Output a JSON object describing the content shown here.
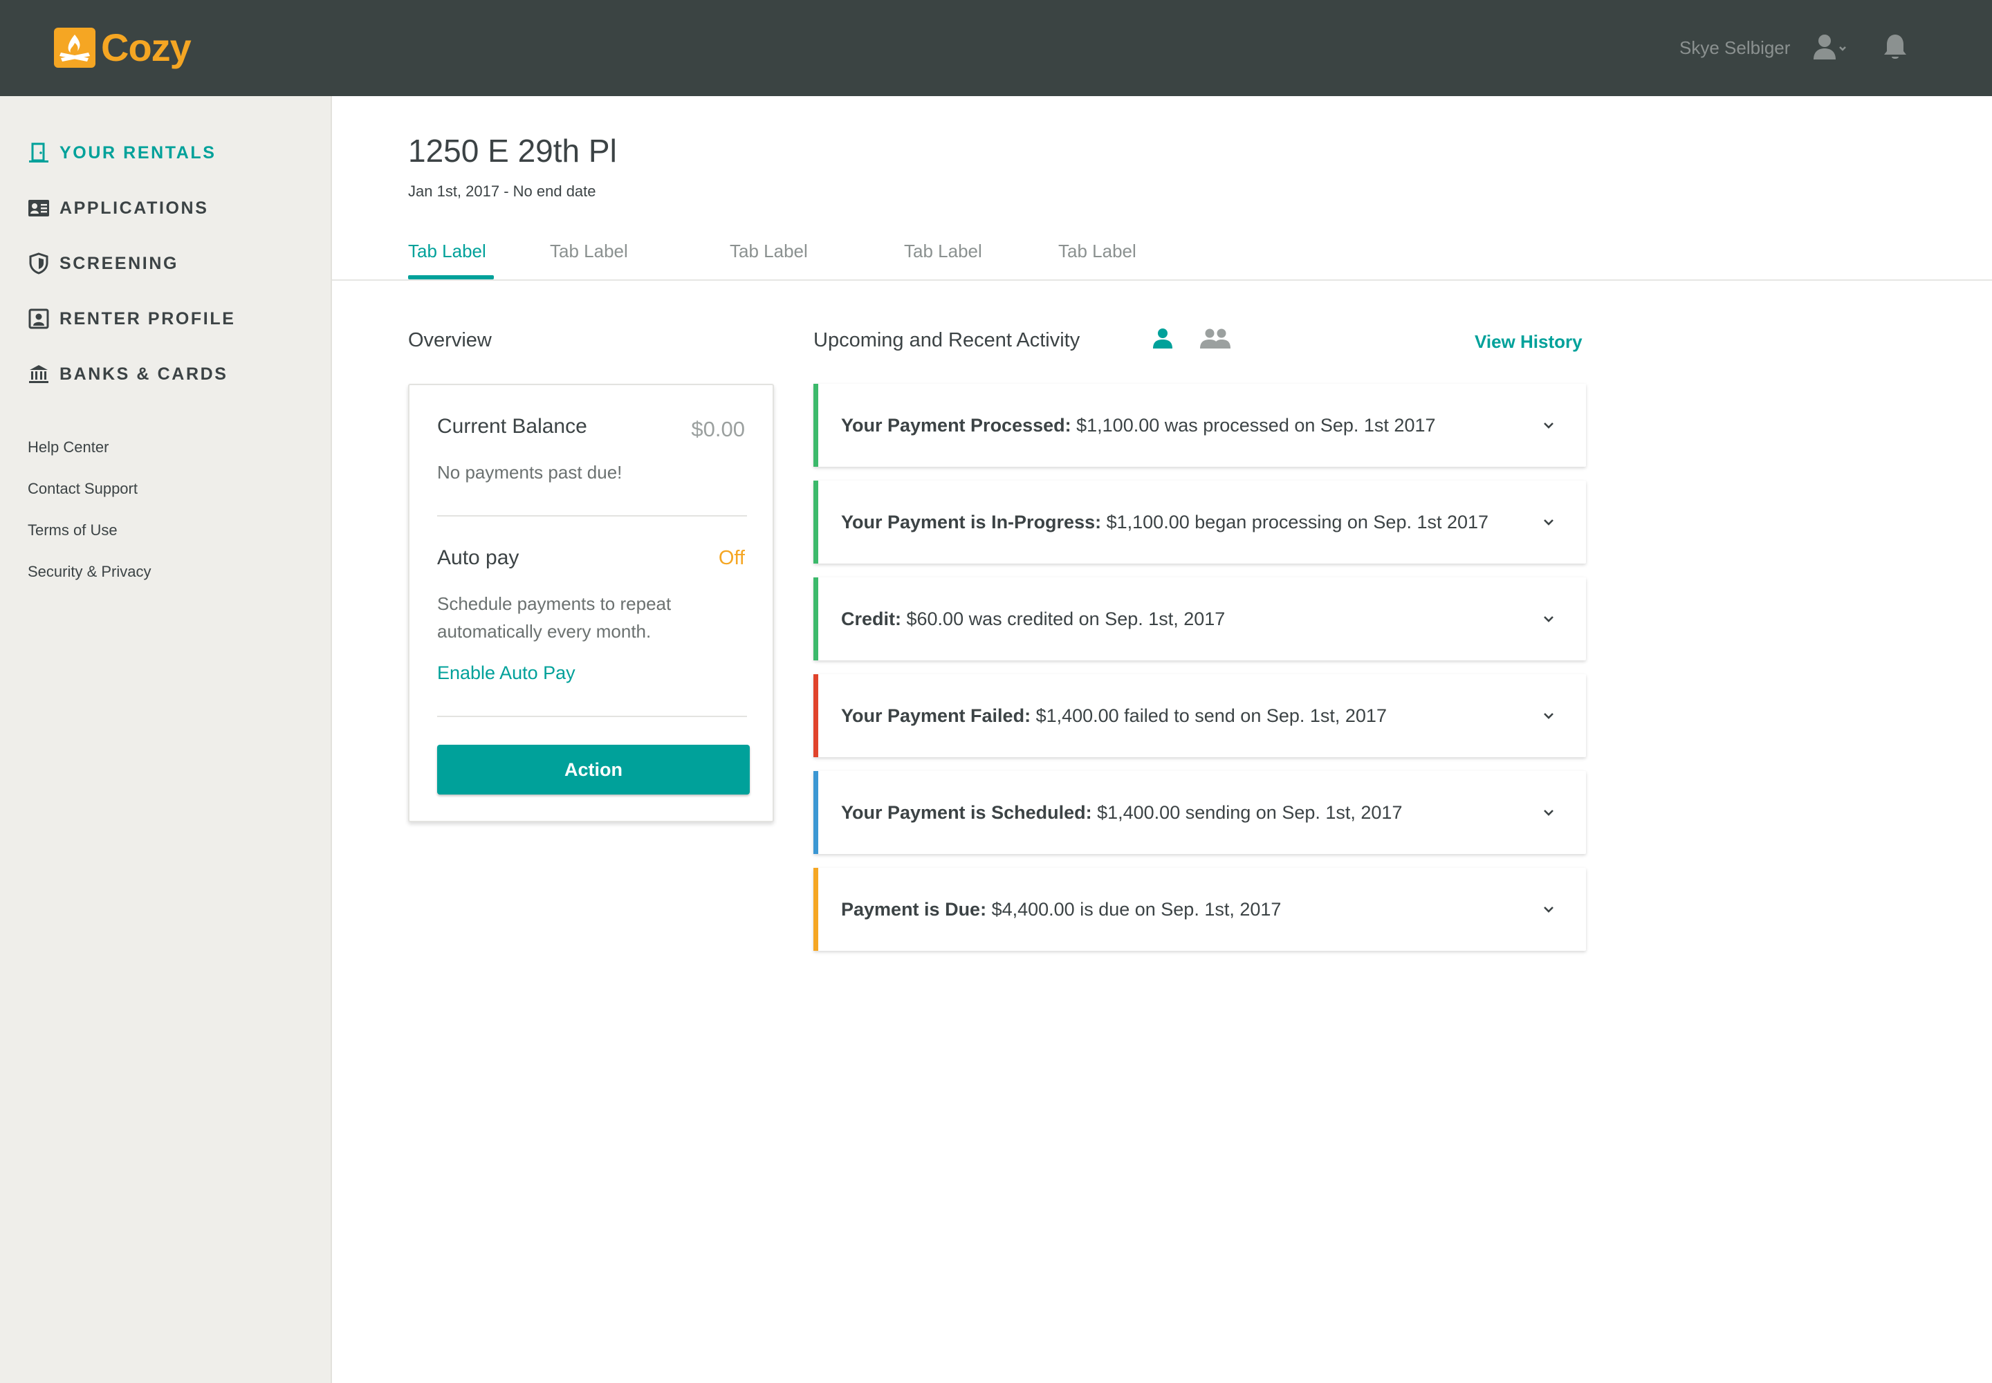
{
  "header": {
    "logo_text": "Cozy",
    "user_name": "Skye Selbiger"
  },
  "sidebar": {
    "nav": [
      {
        "label": "YOUR RENTALS",
        "icon": "door-icon",
        "active": true
      },
      {
        "label": "APPLICATIONS",
        "icon": "id-card-icon",
        "active": false
      },
      {
        "label": "SCREENING",
        "icon": "shield-icon",
        "active": false
      },
      {
        "label": "RENTER PROFILE",
        "icon": "profile-icon",
        "active": false
      },
      {
        "label": "BANKS & CARDS",
        "icon": "bank-icon",
        "active": false
      }
    ],
    "links": [
      "Help Center",
      "Contact Support",
      "Terms of Use",
      "Security & Privacy"
    ]
  },
  "page": {
    "title": "1250 E 29th Pl",
    "subtitle": "Jan 1st, 2017 - No end date",
    "tabs": [
      "Tab Label",
      "Tab Label",
      "Tab Label",
      "Tab Label",
      "Tab Label"
    ],
    "active_tab": 0
  },
  "overview": {
    "title": "Overview",
    "balance_label": "Current Balance",
    "balance_value": "$0.00",
    "balance_note": "No payments past due!",
    "autopay_label": "Auto pay",
    "autopay_status": "Off",
    "autopay_desc_line1": "Schedule payments to repeat",
    "autopay_desc_line2": "automatically every month.",
    "enable_link": "Enable Auto Pay",
    "action_label": "Action"
  },
  "activity": {
    "title": "Upcoming and Recent Activity",
    "view_history": "View History",
    "items": [
      {
        "bold": "Your Payment Processed:",
        "text": " $1,100.00 was processed on Sep. 1st 2017",
        "color": "#3cb96b"
      },
      {
        "bold": "Your Payment is In-Progress:",
        "text": " $1,100.00 began processing on Sep. 1st 2017",
        "color": "#3cb96b"
      },
      {
        "bold": "Credit:",
        "text": " $60.00 was credited on Sep. 1st, 2017",
        "color": "#3cb96b"
      },
      {
        "bold": "Your Payment Failed:",
        "text": " $1,400.00 failed to send on Sep. 1st, 2017",
        "color": "#e0432b"
      },
      {
        "bold": "Your Payment is Scheduled:",
        "text": " $1,400.00 sending on Sep. 1st, 2017",
        "color": "#3b97d3"
      },
      {
        "bold": "Payment is Due:",
        "text": " $4,400.00 is due on Sep. 1st, 2017",
        "color": "#f5a623"
      }
    ]
  },
  "colors": {
    "accent": "#00a19a",
    "header_bg": "#3b4443",
    "brand": "#f5a623",
    "sidebar_bg": "#efeeea"
  }
}
